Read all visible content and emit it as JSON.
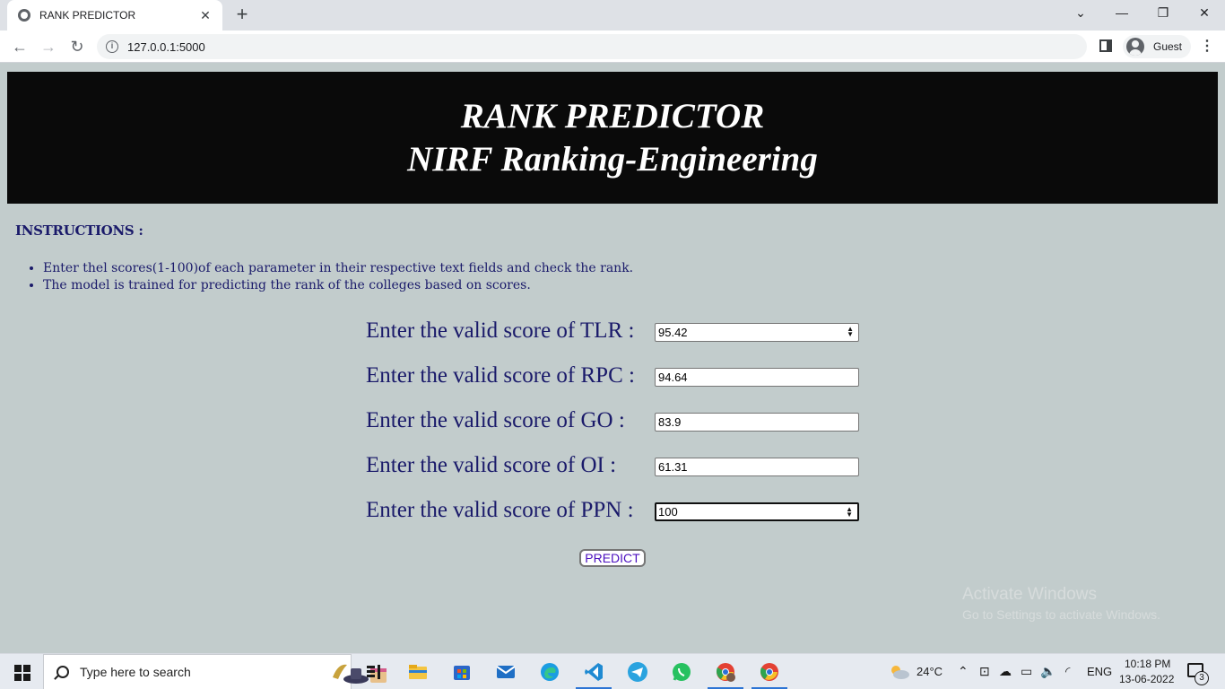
{
  "browser": {
    "tab_title": "RANK PREDICTOR",
    "url": "127.0.0.1:5000",
    "profile_label": "Guest"
  },
  "page": {
    "title_line1": "RANK PREDICTOR",
    "title_line2": "NIRF Ranking-Engineering",
    "instructions_heading": "INSTRUCTIONS :",
    "instructions": [
      "Enter thel scores(1-100)of each parameter in their respective text fields and check the rank.",
      "The model is trained for predicting the rank of the colleges based on scores."
    ],
    "fields": [
      {
        "label": "Enter the valid score of TLR :",
        "value": "95.42"
      },
      {
        "label": "Enter the valid score of RPC :",
        "value": "94.64"
      },
      {
        "label": "Enter the valid score of GO :",
        "value": "83.9"
      },
      {
        "label": "Enter the valid score of OI :",
        "value": "61.31"
      },
      {
        "label": "Enter the valid score of PPN :",
        "value": "100"
      }
    ],
    "predict_label": "PREDICT"
  },
  "watermark": {
    "line1": "Activate Windows",
    "line2": "Go to Settings to activate Windows."
  },
  "taskbar": {
    "search_placeholder": "Type here to search",
    "temperature": "24°C",
    "language": "ENG",
    "time": "10:18 PM",
    "date": "13-06-2022",
    "notification_count": "3"
  }
}
